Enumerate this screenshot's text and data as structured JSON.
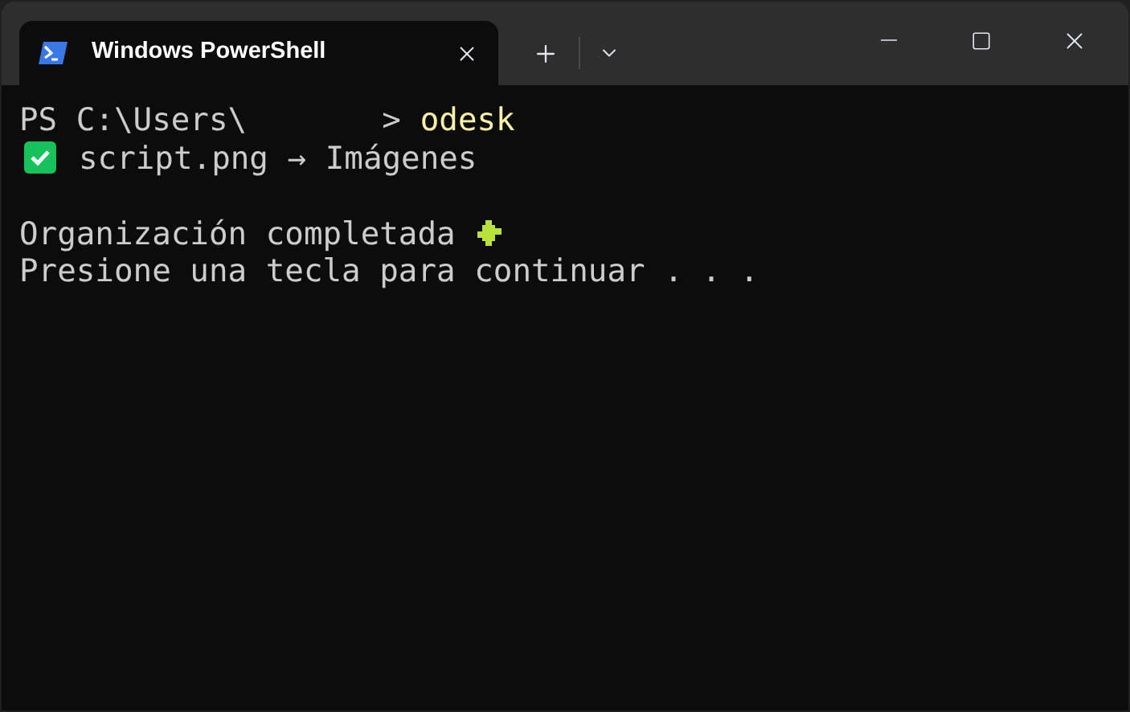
{
  "tab": {
    "title": "Windows PowerShell",
    "selected": true
  },
  "lines": [
    {
      "kind": "prompt",
      "prefix": "PS C:\\Users\\",
      "suffix": ">",
      "command": "odesk"
    },
    {
      "kind": "check",
      "text": "script.png → Imágenes"
    },
    {
      "kind": "blank"
    },
    {
      "kind": "puzzle",
      "text": "Organización completada"
    },
    {
      "kind": "plain",
      "text": "Presione una tecla para continuar . . ."
    }
  ]
}
